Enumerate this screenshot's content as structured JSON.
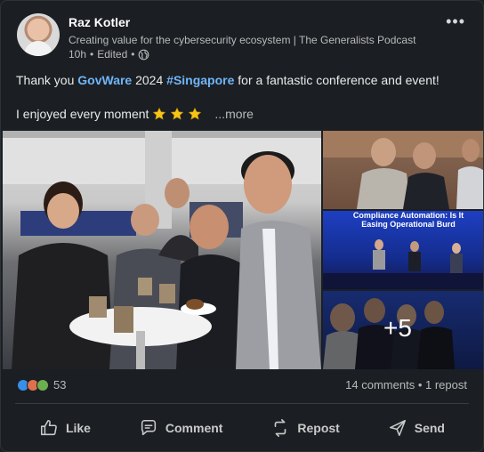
{
  "author": {
    "name": "Raz Kotler",
    "headline": "Creating value for the cybersecurity ecosystem | The Generalists Podcast",
    "time": "10h",
    "edited": "Edited",
    "separator": "•"
  },
  "post": {
    "text_prefix": "Thank you ",
    "mention": "GovWare",
    "text_mid": " 2024 ",
    "hashtag": "#Singapore",
    "text_suffix": " for a fantastic conference and event!",
    "line2": "I enjoyed every moment",
    "see_more": "...more"
  },
  "gallery": {
    "extra_count": "+5",
    "banner_text": "Compliance Automation: Is It Easing Operational Burd"
  },
  "social": {
    "reaction_count": "53",
    "comments": "14 comments",
    "dot": "•",
    "reposts": "1 repost",
    "colors": {
      "like": "#378fe9",
      "love": "#df704d",
      "support": "#6dae4f"
    }
  },
  "actions": {
    "like": "Like",
    "comment": "Comment",
    "repost": "Repost",
    "send": "Send"
  }
}
